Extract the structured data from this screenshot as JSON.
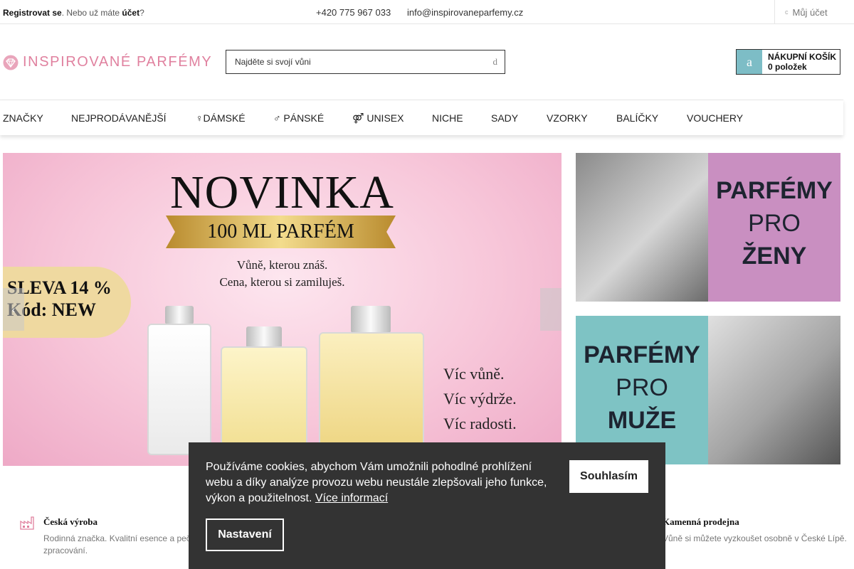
{
  "topbar": {
    "register": "Registrovat se",
    "middle": ". Nebo už máte ",
    "account_link": "účet",
    "question": "?",
    "phone": "+420 775 967 033",
    "email": "info@inspirovaneparfemy.cz",
    "my_account": "Můj účet"
  },
  "header": {
    "logo": "INSPIROVANÉ PARFÉMY",
    "search_placeholder": "Najděte si svojí vůni",
    "search_button": "d",
    "cart_icon": "a",
    "cart_title": "NÁKUPNÍ KOŠÍK",
    "cart_count": "0 položek"
  },
  "nav": [
    "ZNAČKY",
    "NEJPRODÁVANĚJŠÍ",
    "♀DÁMSKÉ",
    "♂ PÁNSKÉ",
    "⚤ UNISEX",
    "NICHE",
    "SADY",
    "VZORKY",
    "BALÍČKY",
    "VOUCHERY"
  ],
  "hero": {
    "headline": "NOVINKA",
    "ribbon": "100 ML PARFÉM",
    "sub1": "Vůně, kterou znáš.",
    "sub2": "Cena, kterou si zamiluješ.",
    "sale_line1": "SLEVA 14 %",
    "sale_line2": "Kód: NEW",
    "tag1": "Víc vůně.",
    "tag2": "Víc výdrže.",
    "tag3": "Víc radosti.",
    "prev": "‹",
    "next": ""
  },
  "banners": {
    "women": {
      "line1": "PARFÉMY",
      "line2": "PRO",
      "line3": "ŽENY"
    },
    "men": {
      "line1": "PARFÉMY",
      "line2": "PRO",
      "line3": "MUŽE"
    }
  },
  "features": [
    {
      "title": "Česká výroba",
      "desc": "Rodinná značka. Kvalitní esence a pečlivé zpracování."
    },
    {
      "title": "Kamenná prodejna",
      "desc": "Vůně si můžete vyzkoušet osobně v České Lípě."
    }
  ],
  "cookie": {
    "message": "Používáme cookies, abychom Vám umožnili pohodlné prohlížení webu a díky analýze provozu webu neustále zlepšovali jeho funkce, výkon a použitelnost. ",
    "more": "Více informací",
    "agree": "Souhlasím",
    "settings": "Nastavení"
  },
  "colors": {
    "brand_pink": "#e0819f",
    "cart_teal": "#7dbdc6",
    "cookie_bg": "#333333",
    "women_banner": "#c98fc1",
    "men_banner": "#7ec3c4"
  }
}
